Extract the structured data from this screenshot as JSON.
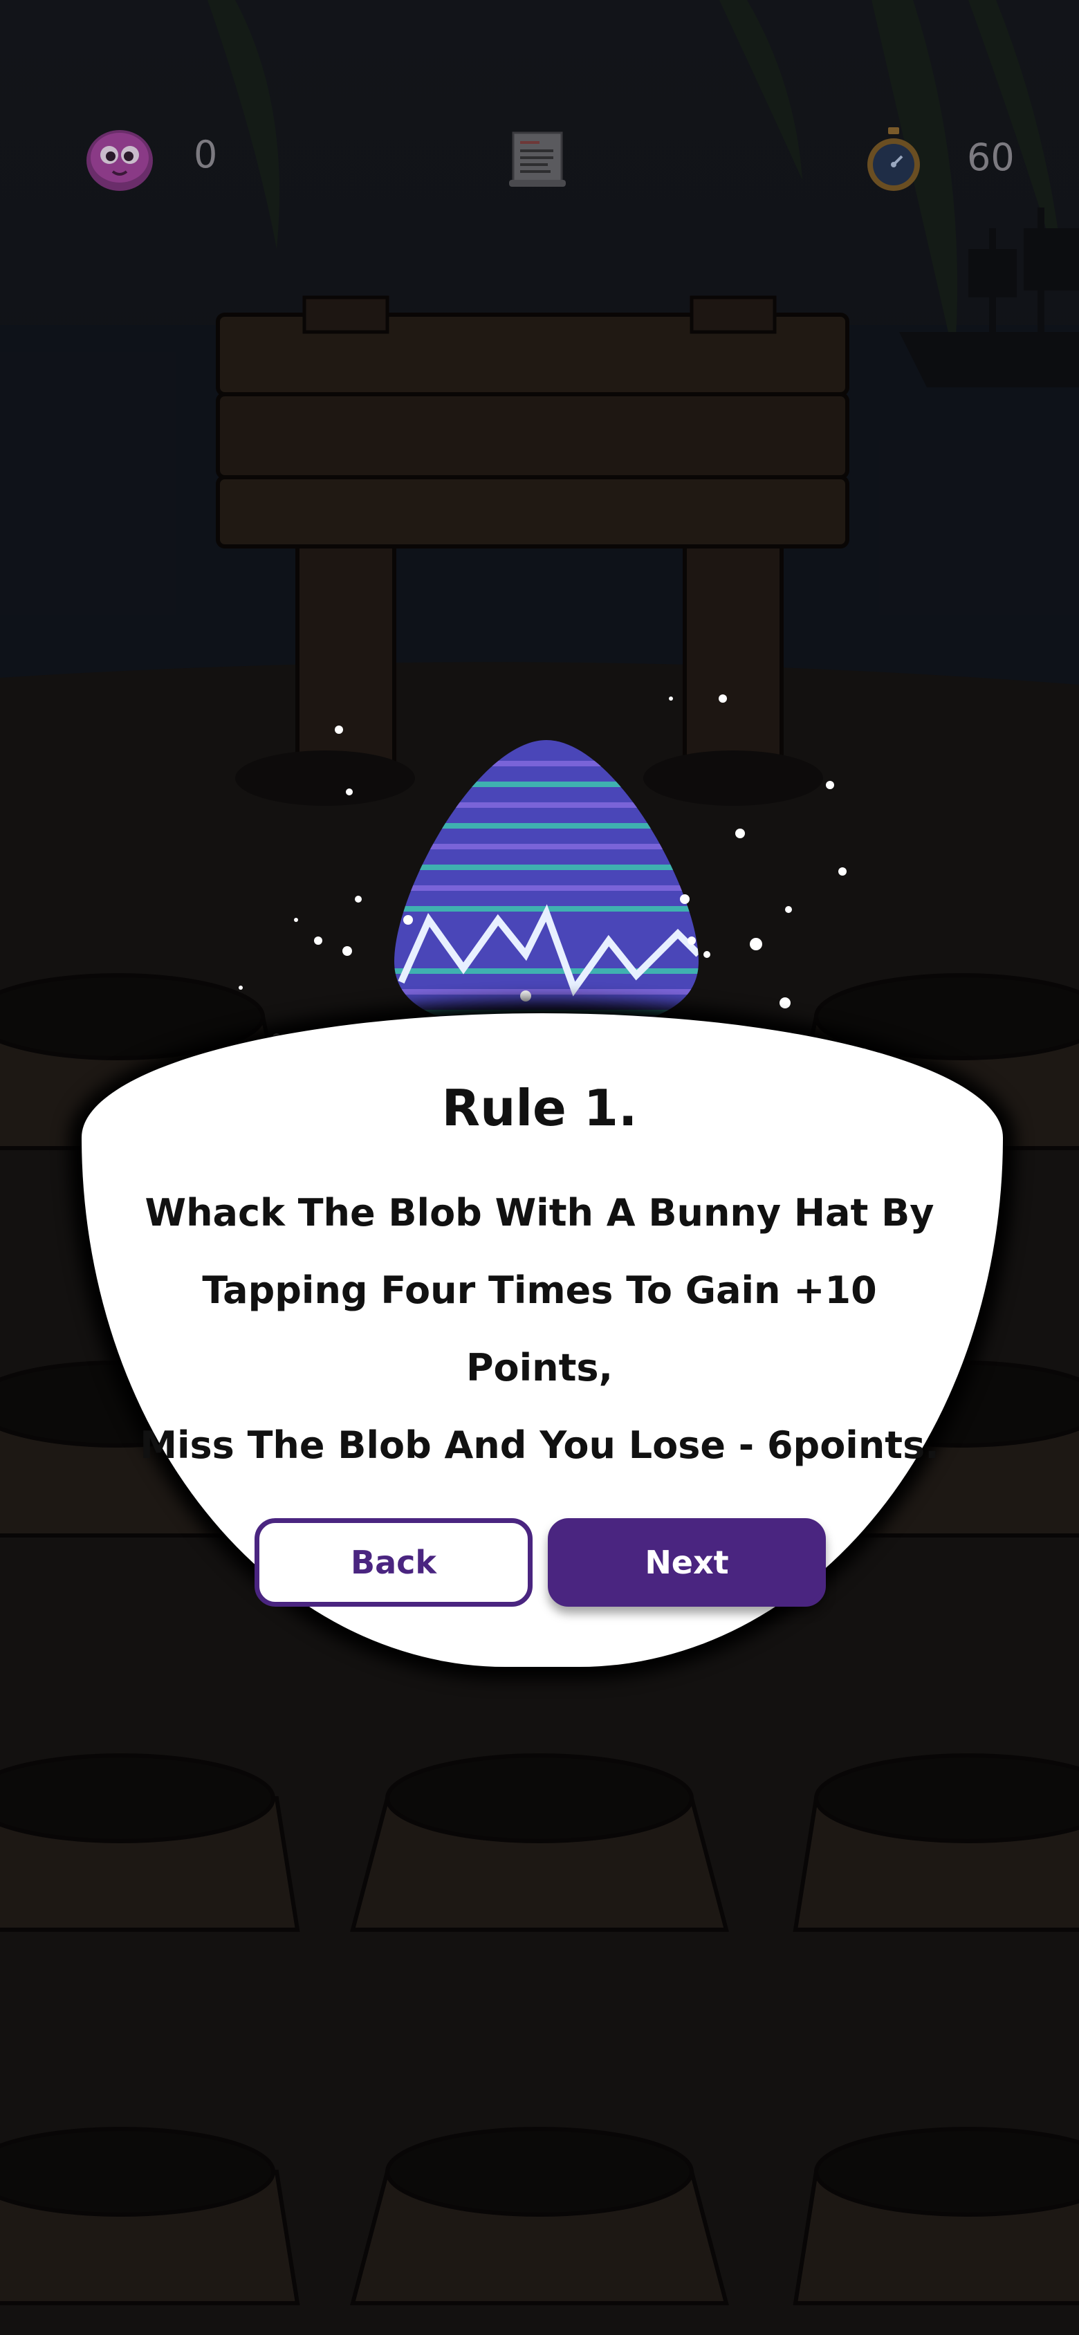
{
  "hud": {
    "score": "0",
    "timer": "60",
    "score_icon": "blob-face-icon",
    "rules_icon": "rules-scroll-icon",
    "timer_icon": "stopwatch-icon"
  },
  "dialog": {
    "title": "Rule 1.",
    "text": "Whack The Blob With A Bunny Hat By\nTapping Four Times To Gain +10 Points,\nMiss The Blob And You Lose - 6points.",
    "back_label": "Back",
    "next_label": "Next"
  },
  "colors": {
    "accent": "#4a2580",
    "overlay_white": "#ffffff",
    "background": "#161418"
  }
}
